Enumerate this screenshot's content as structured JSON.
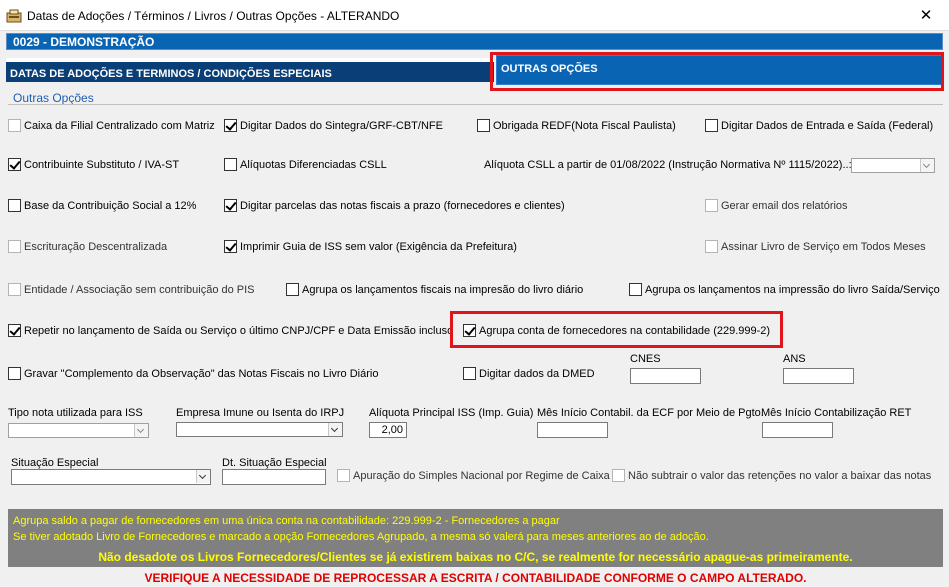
{
  "window": {
    "title": "Datas de Adoções / Términos / Livros / Outras Opções   -  ALTERANDO",
    "close": "✕"
  },
  "company": "0029   -   DEMONSTRAÇÃO",
  "tabs": {
    "tab1": "DATAS DE ADOÇÕES E TERMINOS / CONDIÇÕES ESPECIAIS",
    "tab2": "OUTRAS OPÇÕES"
  },
  "section_title": "Outras Opções",
  "checks": {
    "caixa_filial": "Caixa da Filial Centralizado com Matriz",
    "sintegra": "Digitar Dados do Sintegra/GRF-CBT/NFE",
    "redf": "Obrigada REDF(Nota Fiscal Paulista)",
    "entrada_saida": "Digitar Dados de Entrada e Saída (Federal)",
    "contribuinte": "Contribuinte Substituto / IVA-ST",
    "csll": "Alíquotas Diferenciadas CSLL",
    "base_contrib": "Base da Contribuição Social a 12%",
    "parcelas": "Digitar parcelas das notas fiscais a prazo (fornecedores e clientes)",
    "email": "Gerar email dos relatórios",
    "escrituracao": "Escrituração Descentralizada",
    "guia_iss": "Imprimir Guia de ISS sem valor (Exigência da Prefeitura)",
    "livro_servico": "Assinar Livro de Serviço em Todos Meses",
    "entidade": "Entidade / Associação sem contribuição do PIS",
    "agrupa_diario": "Agrupa os lançamentos fiscais na impresão do livro diário",
    "agrupa_saida": "Agrupa os lançamentos na impressão do livro Saída/Serviço",
    "repetir": "Repetir no lançamento de Saída ou Serviço o último CNPJ/CPF e Data Emissão incluso",
    "agrupa_forn": "Agrupa conta de fornecedores na contabilidade (229.999-2)",
    "gravar": "Gravar \"Complemento da Observação\" das Notas Fiscais no Livro Diário",
    "dmed": "Digitar dados da DMED",
    "simples": "Apuração do Simples Nacional por Regime de Caixa",
    "retencoes": "Não subtrair o valor das retenções no valor a baixar das notas"
  },
  "labels": {
    "aliquota_csll": "Alíquota CSLL a partir de 01/08/2022 (Instrução Normativa Nº 1115/2022)..:",
    "cnes": "CNES",
    "ans": "ANS",
    "tipo_nota": "Tipo nota utilizada para ISS",
    "empresa_imune": "Empresa Imune ou Isenta do IRPJ",
    "aliquota_iss": "Alíquota Principal ISS (Imp. Guia)",
    "mes_ecf": "Mês Início Contabil. da ECF por Meio de Pgto.",
    "mes_ret": "Mês Início Contabilização RET",
    "situacao": "Situação Especial",
    "dt_situacao": "Dt. Situação Especial"
  },
  "values": {
    "aliquota_iss": "2,00"
  },
  "messages": {
    "line1": "Agrupa saldo a pagar de fornecedores em uma única conta na contabilidade:  229.999-2 - Fornecedores a pagar",
    "line2": "Se tiver adotado Livro de Fornecedores e marcado a opção Fornecedores Agrupado, a mesma só valerá para meses anteriores ao de adoção.",
    "line3": "Não desadote os Livros Fornecedores/Clientes se já existirem baixas no C/C, se realmente for necessário apague-as primeiramente.",
    "line4": "VERIFIQUE A NECESSIDADE DE REPROCESSAR A ESCRITA / CONTABILIDADE CONFORME O CAMPO ALTERADO."
  },
  "colors": {
    "accent": "#0a64b4",
    "highlight": "#e0141a",
    "warning": "#ffff00",
    "alert": "#e00000"
  }
}
